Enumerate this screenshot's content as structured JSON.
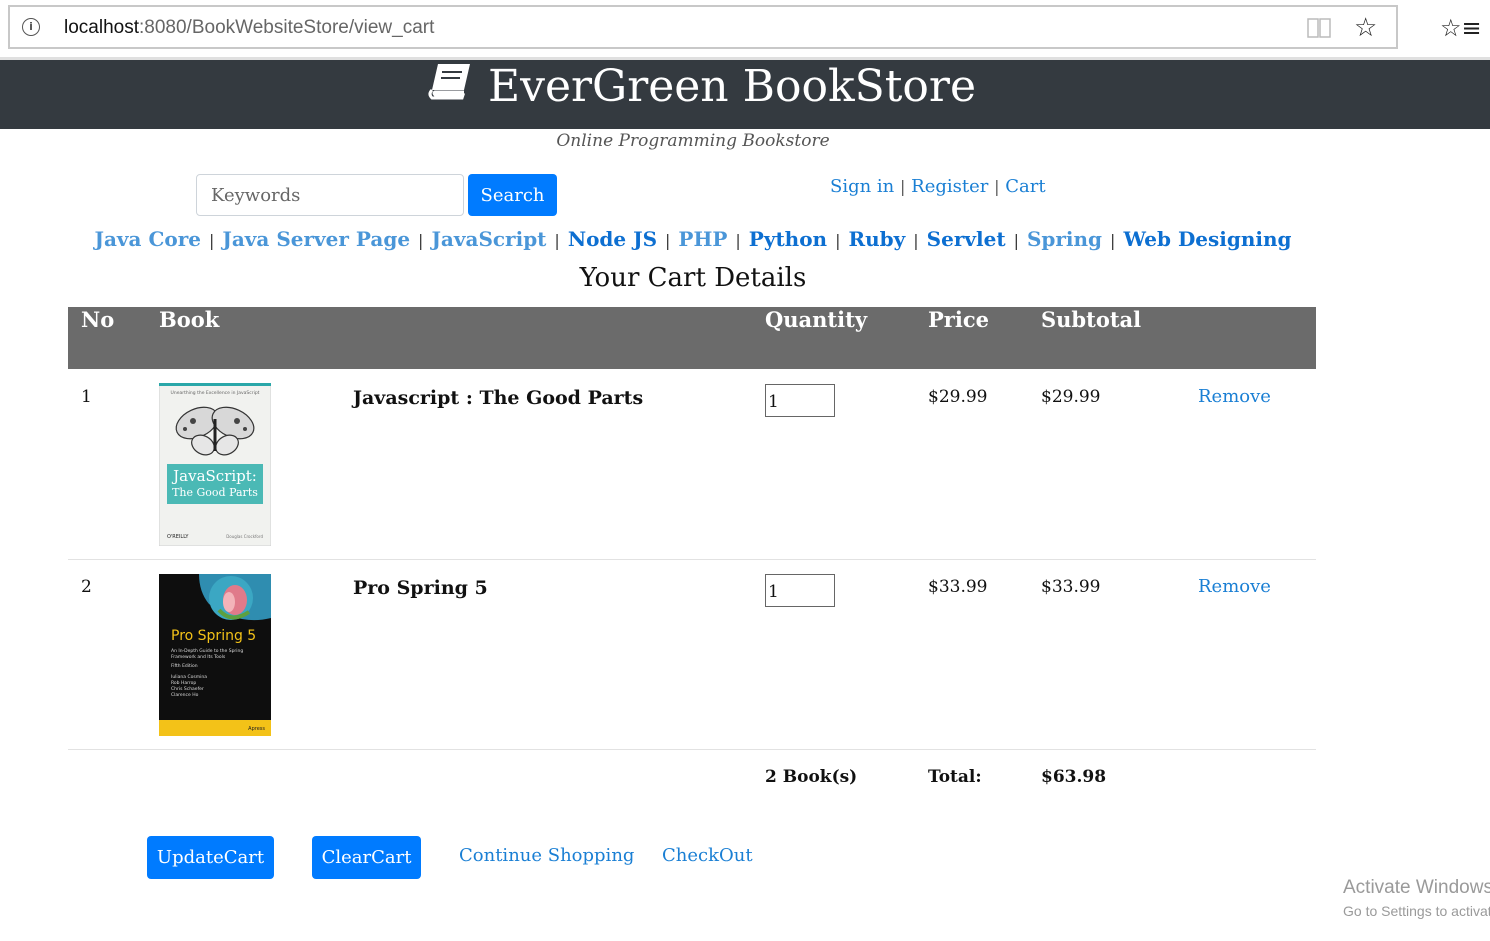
{
  "browser": {
    "url_host": "localhost",
    "url_rest": ":8080/BookWebsiteStore/view_cart",
    "icons": {
      "info": "info-icon",
      "reader": "reader-view-icon",
      "favorite": "star-icon",
      "favorites_hub": "favorites-list-icon"
    }
  },
  "header": {
    "site_title": "EverGreen BookStore",
    "tagline": "Online Programming Bookstore",
    "logo_icon": "book-icon",
    "banner_color": "#343a40"
  },
  "search": {
    "placeholder": "Keywords",
    "button_label": "Search"
  },
  "account": {
    "sign_in": "Sign in",
    "register": "Register",
    "cart": "Cart",
    "separator": "|"
  },
  "categories": [
    "Java Core",
    "Java Server Page",
    "JavaScript",
    "Node JS",
    "PHP",
    "Python",
    "Ruby",
    "Servlet",
    "Spring",
    "Web Designing"
  ],
  "cart": {
    "title": "Your Cart Details",
    "columns": {
      "no": "No",
      "book": "Book",
      "quantity": "Quantity",
      "price": "Price",
      "subtotal": "Subtotal"
    },
    "items": [
      {
        "no": "1",
        "title": "Javascript : The Good Parts",
        "quantity": "1",
        "price": "$29.99",
        "subtotal": "$29.99",
        "remove": "Remove",
        "cover": {
          "top_text": "Unearthing the Excellence in JavaScript",
          "title_line1": "JavaScript:",
          "title_line2": "The Good Parts",
          "publisher": "O'REILLY",
          "author": "Douglas Crockford"
        }
      },
      {
        "no": "2",
        "title": "Pro Spring 5",
        "quantity": "1",
        "price": "$33.99",
        "subtotal": "$33.99",
        "remove": "Remove",
        "cover": {
          "title": "Pro Spring 5",
          "subtitle_line1": "An In-Depth Guide to the Spring",
          "subtitle_line2": "Framework and Its Tools",
          "edition": "Fifth Edition",
          "authors": [
            "Iuliana Cosmina",
            "Rob Harrop",
            "Chris Schaefer",
            "Clarence Ho"
          ],
          "publisher": "Apress"
        }
      }
    ],
    "summary": {
      "count": "2 Book(s)",
      "total_label": "Total:",
      "total": "$63.98"
    }
  },
  "actions": {
    "update": "UpdateCart",
    "clear": "ClearCart",
    "continue": "Continue Shopping",
    "checkout": "CheckOut"
  },
  "watermark": {
    "line1": "Activate Windows",
    "line2": "Go to Settings to activate Windows."
  },
  "colors": {
    "accent": "#007bff",
    "table_header": "#6b6b6b",
    "link": "#1a7fd4"
  }
}
